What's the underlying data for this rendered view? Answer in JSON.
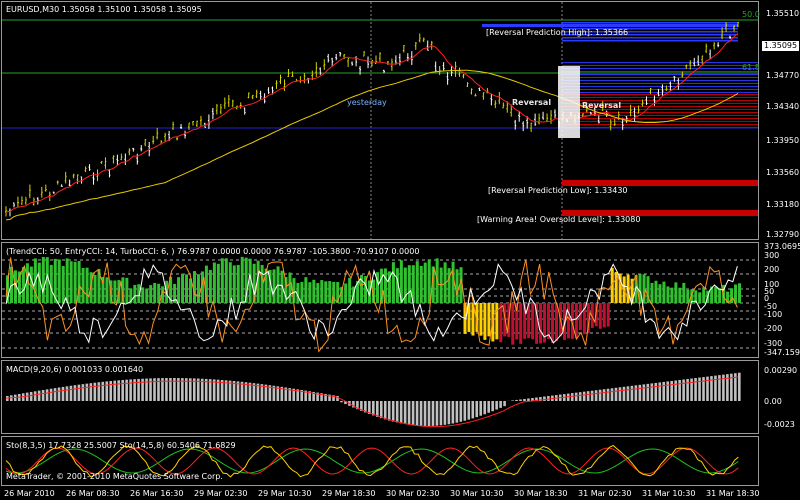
{
  "colors": {
    "background": "#000000",
    "bull_candle": "#d4d400",
    "bear_candle": "#ffffff",
    "ma_fast": "#ff2020",
    "ma_slow": "#e8c800",
    "hline_blue": "#1f1fd0",
    "hline_green": "#2aa02a",
    "fib_blue": "#2a3aff",
    "fib_red": "#c80000",
    "cci_hist_green": "#30c030",
    "cci_hist_red": "#c01030",
    "cci_hist_yellow": "#ffd000",
    "cci_line": "#ffffff",
    "cci_line2": "#ff9020",
    "macd_hist": "#c0c0c0",
    "macd_signal": "#ff2020",
    "stoch_a": "#ffd000",
    "stoch_b": "#ff2020",
    "stoch_c": "#20c020"
  },
  "main": {
    "title": "EURUSD,M30  1.35058 1.35100 1.35058 1.35095",
    "price_labels": [
      "1.35510",
      "1.34770",
      "1.34340",
      "1.33950",
      "1.33560",
      "1.33180",
      "1.32790"
    ],
    "current_price": "1.35095",
    "yesterday_label": "yesterday",
    "fib_labels": [
      "50.0",
      "61.8"
    ],
    "reversal_high": "[Reversal Prediction High]: 1.35366",
    "reversal_low": "[Reversal Prediction Low]: 1.33430",
    "warning": "[Warning Area! Oversold Level]: 1.33080",
    "overlay_text": "Reversal"
  },
  "cci": {
    "title": "(TrendCCI: 50, EntryCCI: 14, TurboCCI: 6, ) 76.9787 0.0000 0.0000 76.9787 -105.3800 -70.9107 0.0000",
    "top_value": "373.0695",
    "bottom_value": "-347.159",
    "levels": [
      "300",
      "200",
      "100",
      "50",
      "0",
      "-50",
      "-100",
      "-200",
      "-300"
    ]
  },
  "macd": {
    "title": "MACD(9,20,6) 0.001033 0.001640",
    "labels": [
      "0.00290",
      "0.00",
      "-0.0023"
    ]
  },
  "stoch": {
    "title": "Sto(8,3,5) 17.7328 25.5007  Sto(14,5,8) 60.5406 71.6829",
    "copyright": "MetaTrader, © 2001-2010 MetaQuotes Software Corp."
  },
  "time_axis": [
    "26 Mar 2010",
    "26 Mar 08:30",
    "26 Mar 16:30",
    "29 Mar 02:30",
    "29 Mar 10:30",
    "29 Mar 18:30",
    "30 Mar 02:30",
    "30 Mar 10:30",
    "30 Mar 18:30",
    "31 Mar 02:30",
    "31 Mar 10:30",
    "31 Mar 18:30"
  ]
}
